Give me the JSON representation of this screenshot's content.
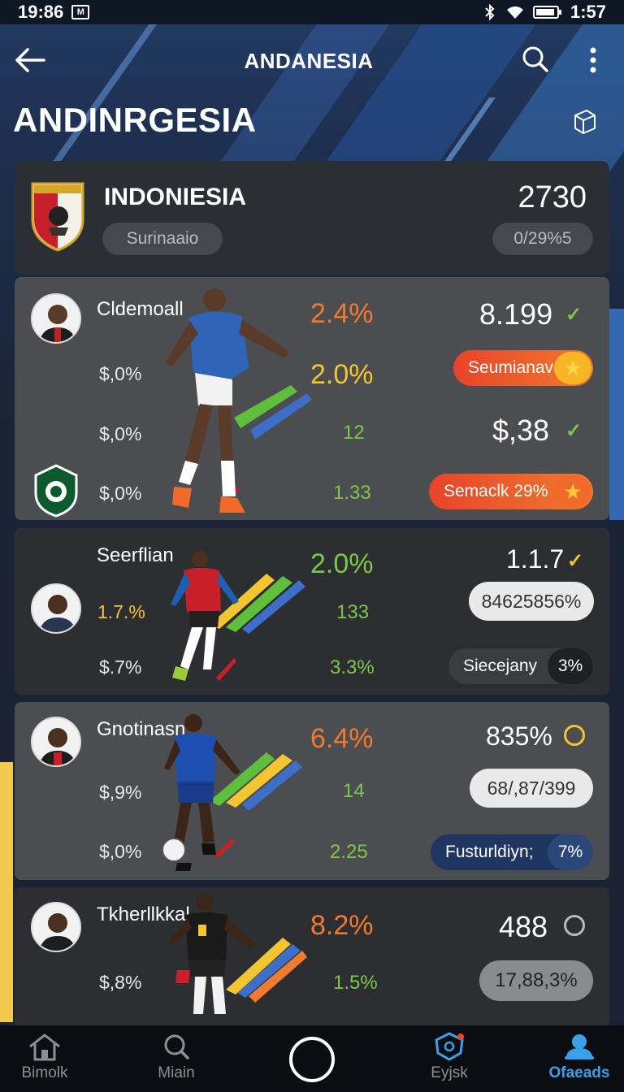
{
  "status_bar": {
    "time_left": "19:86",
    "time_right": "1:57"
  },
  "header": {
    "title": "ANDANESIA"
  },
  "page_title": "ANDINRGESIA",
  "team": {
    "name": "INDONIESIA",
    "score": "2730",
    "subtitle": "Surinaaio",
    "ratio": "0/29%5"
  },
  "players": [
    {
      "name": "Cldemoall",
      "stats_left": [
        "$,0%",
        "$,0%",
        "$,0%"
      ],
      "pct_main": "2.4%",
      "pct_second": "2.0%",
      "small_values": [
        "12",
        "1.33"
      ],
      "value_top": "8.199",
      "value_mid": "$,38",
      "pill_top": "Seumianav",
      "pill_bottom": "Semaclk 29%"
    },
    {
      "name": "Seerflian",
      "stats_left": [
        "1.7.%",
        "$.7%"
      ],
      "pct_main": "2.0%",
      "small_values": [
        "133",
        "3.3%"
      ],
      "value_top": "1.1.7",
      "pill_white": "84625856%",
      "pill_duo": "Siecejany",
      "pill_duo_tail": "3%"
    },
    {
      "name": "Gnotinasn",
      "stats_left": [
        "$,9%",
        "$,0%"
      ],
      "pct_main": "6.4%",
      "small_values": [
        "14",
        "2.25"
      ],
      "value_top": "835%",
      "pill_white": "68/,87/399",
      "pill_duo": "Fusturldiyn;",
      "pill_duo_tail": "7%"
    },
    {
      "name": "Tkherllkkal",
      "stats_left": [
        "$,8%"
      ],
      "pct_main": "8.2%",
      "small_values": [
        "1.5%"
      ],
      "value_top": "488",
      "pill_grey": "17,88,3%"
    }
  ],
  "bottom_nav": [
    {
      "label": "Bimolk",
      "icon": "home-icon"
    },
    {
      "label": "Miain",
      "icon": "search-icon"
    },
    {
      "label": "",
      "icon": "record-icon"
    },
    {
      "label": "Eyjsk",
      "icon": "shield-icon"
    },
    {
      "label": "Ofaeads",
      "icon": "profile-icon"
    }
  ],
  "colors": {
    "accent_orange": "#f07a2e",
    "accent_yellow": "#f2c531",
    "accent_green": "#7cc84a",
    "active_nav": "#3aa0e8"
  }
}
